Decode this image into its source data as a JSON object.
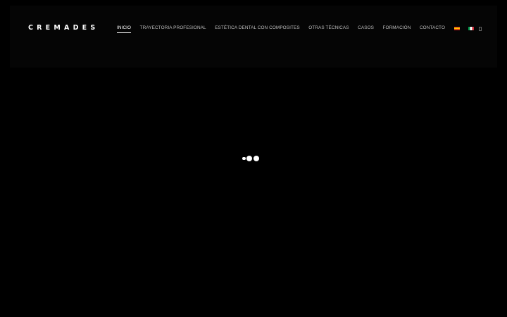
{
  "header": {
    "logo_text": "CREMADES",
    "nav": [
      {
        "label": "INICIO",
        "active": true
      },
      {
        "label": "TRAYECTORIA PROFESIONAL",
        "active": false
      },
      {
        "label": "ESTÉTICA DENTAL CON COMPOSITES",
        "active": false
      },
      {
        "label": "OTRAS TÉCNICAS",
        "active": false
      },
      {
        "label": "CASOS",
        "active": false
      },
      {
        "label": "FORMACIÓN",
        "active": false
      },
      {
        "label": "CONTACTO",
        "active": false
      }
    ],
    "languages": [
      {
        "icon": "spain-flag-icon"
      },
      {
        "icon": "italy-flag-icon"
      }
    ],
    "search_icon": "search-icon"
  },
  "preloader": {
    "icon": "loading-dots-icon"
  },
  "colors": {
    "background": "#000000",
    "header_background": "#050505",
    "nav_text": "#bdbdbd",
    "nav_active": "#ffffff"
  }
}
